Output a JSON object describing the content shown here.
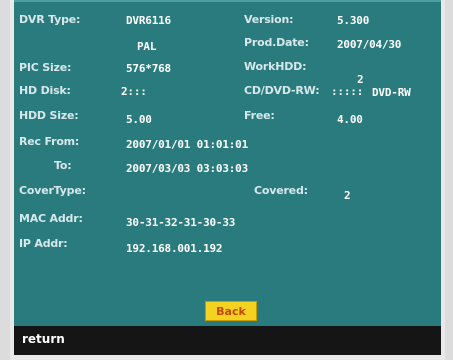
{
  "info": {
    "dvr_type": {
      "label": "DVR Type:",
      "value": "DVR6116"
    },
    "version": {
      "label": "Version:",
      "value": "5.300"
    },
    "video_std": {
      "value": "PAL"
    },
    "prod_date": {
      "label": "Prod.Date:",
      "value": "2007/04/30"
    },
    "pic_size": {
      "label": "PIC Size:",
      "value": "576*768"
    },
    "work_hdd": {
      "label": "WorkHDD:",
      "value": "2"
    },
    "hd_disk": {
      "label": "HD Disk:",
      "value": "2:::"
    },
    "cd_dvd": {
      "label": "CD/DVD-RW:",
      "indicator": ":::::",
      "value": "DVD-RW"
    },
    "hdd_size": {
      "label": "HDD Size:",
      "value": "5.00"
    },
    "free": {
      "label": "Free:",
      "value": "4.00"
    },
    "rec_from": {
      "label": "Rec From:",
      "value": "2007/01/01 01:01:01"
    },
    "rec_to": {
      "label": "To:",
      "value": "2007/03/03 03:03:03"
    },
    "cover_type": {
      "label": "CoverType:"
    },
    "covered": {
      "label": "Covered:",
      "value": "2"
    },
    "mac_addr": {
      "label": "MAC Addr:",
      "value": "30-31-32-31-30-33"
    },
    "ip_addr": {
      "label": "IP Addr:",
      "value": "192.168.001.192"
    }
  },
  "buttons": {
    "back_label": "Back"
  },
  "statusbar": {
    "text": "return"
  },
  "colors": {
    "panel": "#2a7b7d",
    "statusbar": "#151515",
    "back_button": "#f5d21f"
  }
}
